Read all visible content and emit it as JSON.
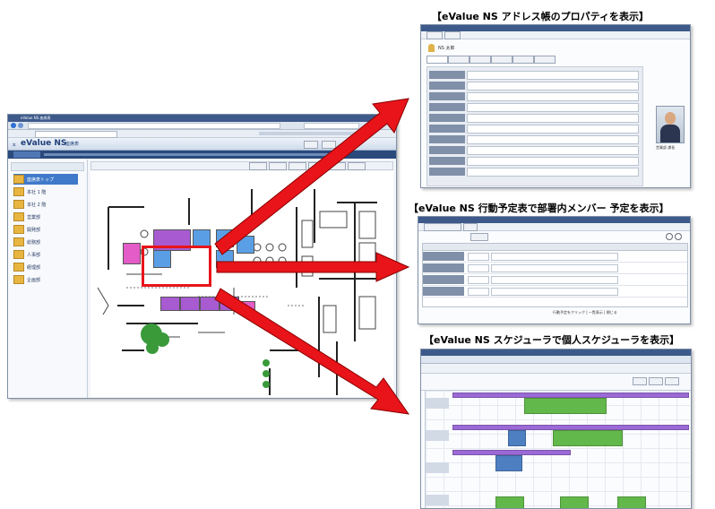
{
  "captions": {
    "address": "【eValue NS アドレス帳のプロパティを表示】",
    "schedule": "【eValue NS 行動予定表で部署内メンバー 予定を表示】",
    "scheduler": "【eValue NS スケジューラで個人スケジューラを表示】"
  },
  "main_window": {
    "title": "eValue NS 座席表",
    "logo": "eValue NS",
    "logo_prefix": "ㅈ",
    "logo_suffix": "座席表",
    "nav_items": [
      "座席表トップ",
      "本社 1 階",
      "本社 2 階",
      "営業部",
      "開発部",
      "総務部",
      "人事部",
      "経理部",
      "企画部"
    ]
  },
  "address_window": {
    "person_name": "NS 太郎",
    "photo_caption": "営業部 課長"
  },
  "schedule_window": {
    "footer_text": "行動予定をクリック | 一覧表示 | 閉じる"
  },
  "scheduler_window": {},
  "colors": {
    "arrow": "#e8141a",
    "highlight": "#e8141a",
    "titlebar": "#3d5a8a",
    "menubar": "#2a4a7c",
    "seat_blue": "#5a9fe6",
    "seat_purple": "#a85bd0",
    "seat_pink": "#e35cc7",
    "tree": "#3a9a3a",
    "event_green": "#62b84a",
    "event_blue": "#4d7fc1",
    "event_purple": "#9b6ad6"
  }
}
